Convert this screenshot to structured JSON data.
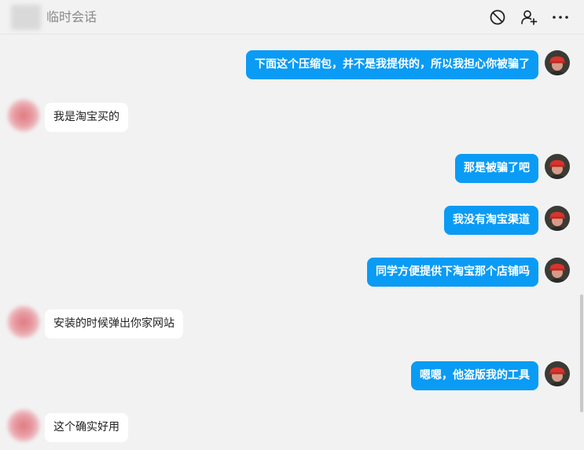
{
  "header": {
    "title": "临时会话",
    "block_icon": "block-icon",
    "add_friend_icon": "add-friend-icon",
    "more_icon": "more-icon"
  },
  "messages": [
    {
      "sender": "me",
      "text": "下面这个压缩包，并不是我提供的，所以我担心你被骗了"
    },
    {
      "sender": "other",
      "text": "我是淘宝买的"
    },
    {
      "sender": "me",
      "text": "那是被骗了吧"
    },
    {
      "sender": "me",
      "text": "我没有淘宝渠道"
    },
    {
      "sender": "me",
      "text": "同学方便提供下淘宝那个店铺吗"
    },
    {
      "sender": "other",
      "text": "安装的时候弹出你家网站"
    },
    {
      "sender": "me",
      "text": "嗯嗯，他盗版我的工具"
    },
    {
      "sender": "other",
      "text": "这个确实好用"
    }
  ],
  "colors": {
    "my_bubble": "#0a9bf5",
    "other_bubble": "#ffffff",
    "background": "#f2f2f2"
  }
}
